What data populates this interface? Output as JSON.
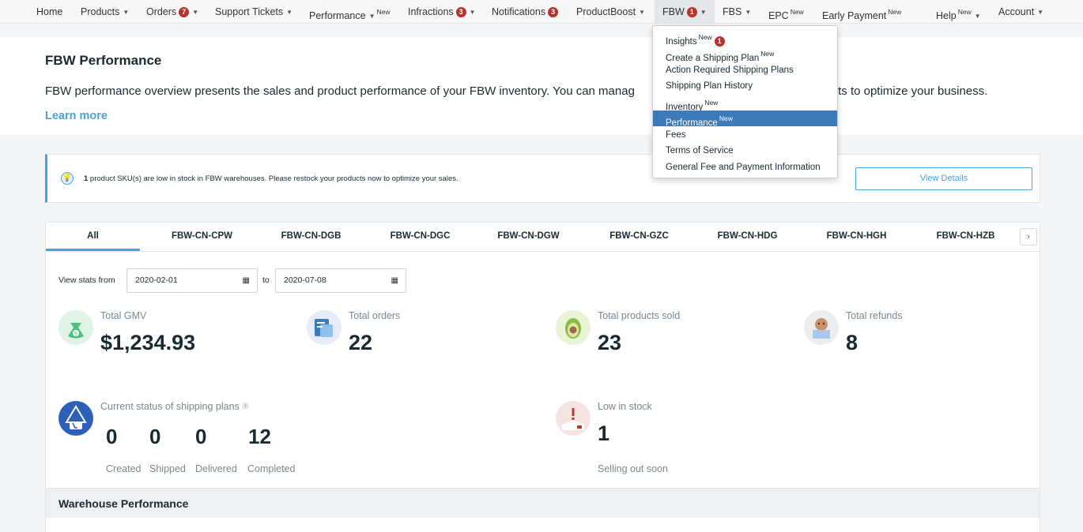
{
  "nav": {
    "home": "Home",
    "products": "Products",
    "orders": "Orders",
    "orders_badge": "7",
    "support": "Support Tickets",
    "performance": "Performance",
    "new": "New",
    "infractions": "Infractions",
    "infractions_badge": "3",
    "notifications": "Notifications",
    "notifications_badge": "3",
    "productboost": "ProductBoost",
    "fbw": "FBW",
    "fbw_badge": "1",
    "fbs": "FBS",
    "epc": "EPC",
    "early_payment": "Early Payment",
    "help": "Help",
    "account": "Account"
  },
  "header": {
    "title": "FBW Performance",
    "description": "FBW performance overview presents the sales and product performance of your FBW inventory. You can manag",
    "description_end": "ducts to optimize your business.",
    "learn_more": "Learn more"
  },
  "alert": {
    "count": "1",
    "text": " product SKU(s) are low in stock in FBW warehouses. Please restock your products now to optimize your sales.",
    "button": "View Details"
  },
  "tabs": [
    "All",
    "FBW-CN-CPW",
    "FBW-CN-DGB",
    "FBW-CN-DGC",
    "FBW-CN-DGW",
    "FBW-CN-GZC",
    "FBW-CN-HDG",
    "FBW-CN-HGH",
    "FBW-CN-HZB"
  ],
  "filters": {
    "view_stats_from": "View stats from",
    "from_date": "2020-02-01",
    "to": "to",
    "to_date": "2020-07-08"
  },
  "stats": {
    "gmv_label": "Total GMV",
    "gmv_value": "$1,234.93",
    "orders_label": "Total orders",
    "orders_value": "22",
    "sold_label": "Total products sold",
    "sold_value": "23",
    "refunds_label": "Total refunds",
    "refunds_value": "8",
    "shipping_label": "Current status of shipping plans",
    "shipping_info": "i",
    "created": "0",
    "shipped": "0",
    "delivered": "0",
    "completed": "12",
    "created_label": "Created",
    "shipped_label": "Shipped",
    "delivered_label": "Delivered",
    "completed_label": "Completed",
    "low_stock_label": "Low in stock",
    "low_stock_value": "1",
    "low_stock_sub": "Selling out soon"
  },
  "warehouse": {
    "title": "Warehouse Performance"
  },
  "dropdown": {
    "insights": "Insights",
    "insights_badge": "1",
    "create_plan": "Create a Shipping Plan",
    "action_required": "Action Required Shipping Plans",
    "history": "Shipping Plan History",
    "inventory": "Inventory",
    "performance": "Performance",
    "fees": "Fees",
    "tos": "Terms of Service",
    "general_fee": "General Fee and Payment Information"
  },
  "colors": {
    "accent": "#4aa3d6",
    "badge": "#b8312f",
    "selected": "#3d7ab8"
  }
}
